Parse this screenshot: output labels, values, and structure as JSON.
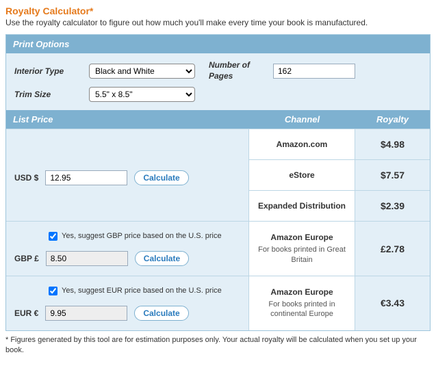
{
  "header": {
    "title": "Royalty Calculator*",
    "subtitle": "Use the royalty calculator to figure out how much you'll make every time your book is manufactured."
  },
  "sections": {
    "print_options": "Print Options",
    "list_price": "List Price",
    "channel": "Channel",
    "royalty": "Royalty"
  },
  "options": {
    "interior_type_label": "Interior Type",
    "interior_type_value": "Black and White",
    "trim_size_label": "Trim Size",
    "trim_size_value": "5.5\" x 8.5\"",
    "pages_label": "Number of Pages",
    "pages_value": "162"
  },
  "buttons": {
    "calculate": "Calculate"
  },
  "prices": {
    "usd": {
      "symbol": "USD  $",
      "value": "12.95"
    },
    "gbp": {
      "symbol": "GBP  £",
      "value": "8.50",
      "suggest": "Yes, suggest GBP price based on the U.S. price"
    },
    "eur": {
      "symbol": "EUR  €",
      "value": "9.95",
      "suggest": "Yes, suggest EUR price based on the U.S. price"
    }
  },
  "rows": {
    "usd": [
      {
        "channel": "Amazon.com",
        "royalty": "$4.98"
      },
      {
        "channel": "eStore",
        "royalty": "$7.57"
      },
      {
        "channel": "Expanded Distribution",
        "royalty": "$2.39"
      }
    ],
    "gbp": {
      "channel": "Amazon Europe",
      "sub": "For books printed in Great Britain",
      "royalty": "£2.78"
    },
    "eur": {
      "channel": "Amazon Europe",
      "sub": "For books printed in continental Europe",
      "royalty": "€3.43"
    }
  },
  "footnote": "* Figures generated by this tool are for estimation purposes only. Your actual royalty will be calculated when you set up your book."
}
